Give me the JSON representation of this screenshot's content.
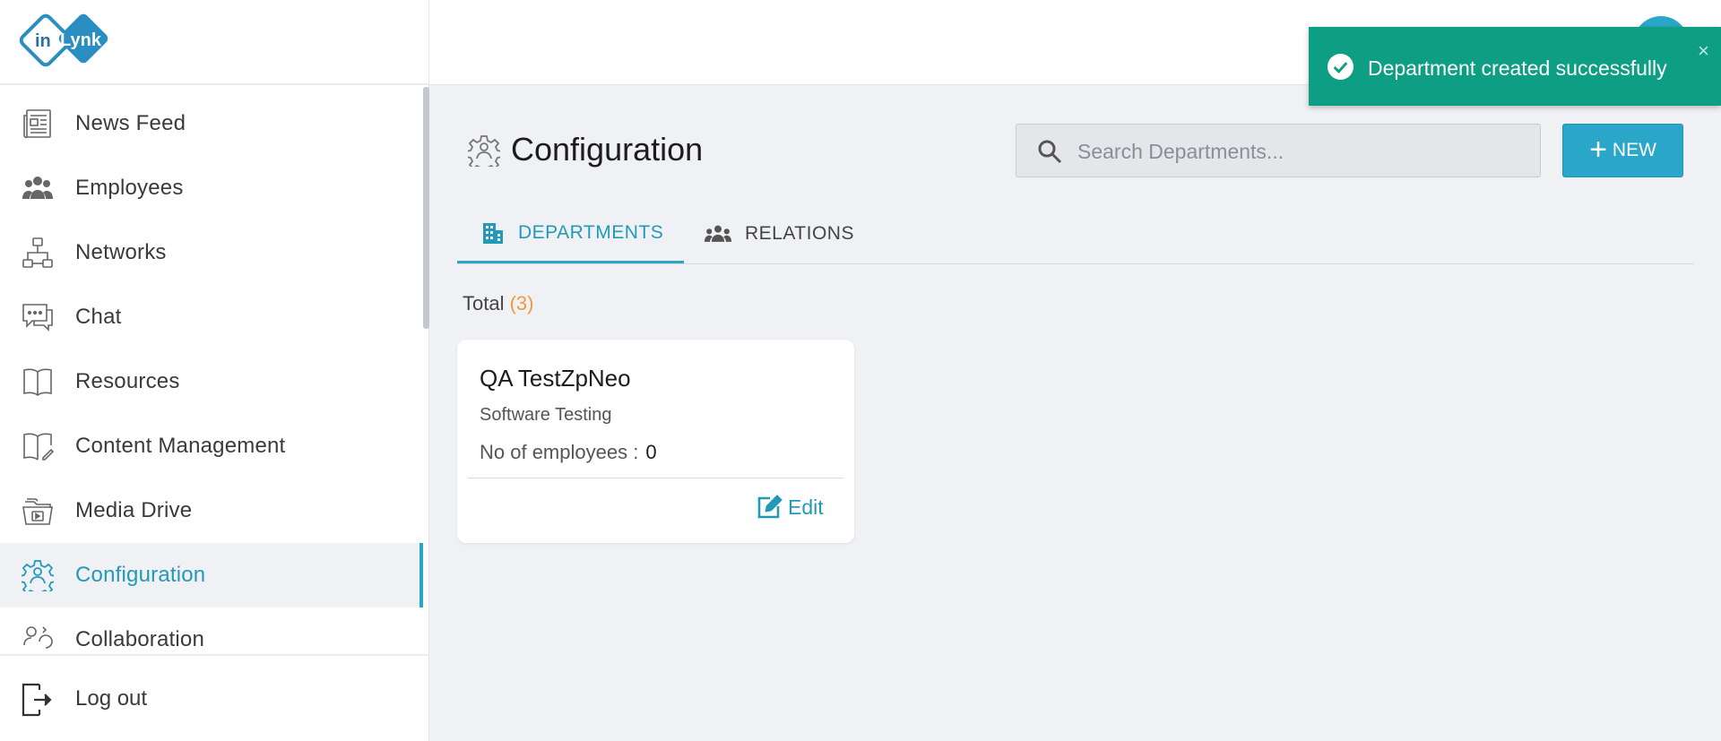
{
  "brand": {
    "logo_text_in": "in",
    "logo_text_lynk": "Lynk"
  },
  "sidebar": {
    "items": [
      {
        "label": "News Feed",
        "icon": "newspaper-icon"
      },
      {
        "label": "Employees",
        "icon": "users-icon"
      },
      {
        "label": "Networks",
        "icon": "network-icon"
      },
      {
        "label": "Chat",
        "icon": "chat-icon"
      },
      {
        "label": "Resources",
        "icon": "book-icon"
      },
      {
        "label": "Content Management",
        "icon": "book-edit-icon"
      },
      {
        "label": "Media Drive",
        "icon": "media-folder-icon"
      },
      {
        "label": "Configuration",
        "icon": "gear-icon",
        "active": true
      },
      {
        "label": "Collaboration",
        "icon": "collaboration-icon"
      }
    ],
    "logout_label": "Log out"
  },
  "toast": {
    "message": "Department created successfully",
    "close": "×"
  },
  "page": {
    "title": "Configuration",
    "search_placeholder": "Search Departments...",
    "new_button_label": "NEW",
    "tabs": [
      {
        "label": "DEPARTMENTS",
        "active": true
      },
      {
        "label": "RELATIONS",
        "active": false
      }
    ],
    "total_label": "Total",
    "total_count": "(3)"
  },
  "departments": [
    {
      "name": "QA TestZpNeo",
      "description": "Software Testing",
      "employees_label": "No of employees :",
      "employees_count": "0",
      "edit_label": "Edit"
    }
  ],
  "colors": {
    "accent": "#2aa7c8",
    "toast": "#0d9e84",
    "count": "#ef9a3c"
  }
}
